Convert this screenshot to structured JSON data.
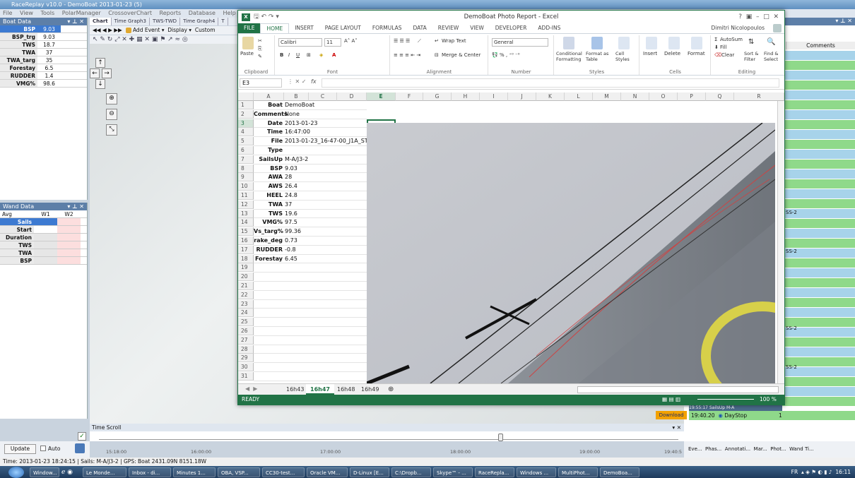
{
  "rr": {
    "title": "RaceReplay v10.0 - DemoBoat 2013-01-23 (5)",
    "menu": [
      "File",
      "View",
      "Tools",
      "PolarManager",
      "CrossoverChart",
      "Reports",
      "Database",
      "Help"
    ],
    "boat_panel": {
      "title": "Boat Data",
      "rows": [
        {
          "label": "BSP",
          "value": "9.03"
        },
        {
          "label": "BSP_trg",
          "value": "9.03"
        },
        {
          "label": "TWS",
          "value": "18.7"
        },
        {
          "label": "TWA",
          "value": "37"
        },
        {
          "label": "TWA_targ",
          "value": "35"
        },
        {
          "label": "Forestay",
          "value": "6.5"
        },
        {
          "label": "RUDDER",
          "value": "1.4"
        },
        {
          "label": "VMG%",
          "value": "98.6"
        }
      ]
    },
    "wand_panel": {
      "title": "Wand Data",
      "headers": [
        "Avg",
        "W1",
        "W2"
      ],
      "rows": [
        "Sails",
        "Start",
        "Duration",
        "TWS",
        "TWA",
        "BSP"
      ]
    },
    "tabs": [
      "Chart",
      "Time Graph3",
      "TWS-TWD",
      "Time Graph4",
      "T"
    ],
    "toolbar": {
      "add_event": "Add Event",
      "display": "Display",
      "custom": "Custom"
    },
    "right_panel": {
      "header": "Comments",
      "labels": [
        "SS-2",
        "SS-2",
        "SS-2",
        "SS-2"
      ],
      "events": [
        {
          "time": "19:40.20",
          "name": "DayStop",
          "value": "1"
        }
      ],
      "partial_row": {
        "time": "19:55:17",
        "name": "SailsUp",
        "value": "M-A"
      },
      "download": "Download"
    },
    "timescroll": {
      "title": "Time Scroll",
      "ticks": [
        "15:18:00",
        "16:00:00",
        "17:00:00",
        "18:00:00",
        "19:00:00",
        "19:40:5"
      ]
    },
    "bottom": {
      "update": "Update",
      "auto": "Auto"
    },
    "statusline": {
      "time": "Time: 2013-01-23 18:24:15",
      "sails": "Sails: M-A/J3-2",
      "gps": "GPS: Boat 2431.09N 8151.18W"
    },
    "bottom_tabs": [
      "Eve...",
      "Phas...",
      "Annotati...",
      "Mar...",
      "Phot...",
      "Wand Ti..."
    ]
  },
  "excel": {
    "title": "DemoBoat Photo Report - Excel",
    "user": "Dimitri Nicolopoulos",
    "tabs": [
      "FILE",
      "HOME",
      "INSERT",
      "PAGE LAYOUT",
      "FORMULAS",
      "DATA",
      "REVIEW",
      "VIEW",
      "DEVELOPER",
      "ADD-INS"
    ],
    "ribbon": {
      "paste": "Paste",
      "font_name": "Calibri",
      "font_size": "11",
      "wrap_text": "Wrap Text",
      "merge": "Merge & Center",
      "number_format": "General",
      "cond_format": "Conditional Formatting",
      "format_table": "Format as Table",
      "cell_styles": "Cell Styles",
      "insert": "Insert",
      "delete": "Delete",
      "format": "Format",
      "autosum": "AutoSum",
      "fill": "Fill",
      "clear": "Clear",
      "sort": "Sort & Filter",
      "find": "Find & Select",
      "groups": [
        "Clipboard",
        "Font",
        "Alignment",
        "Number",
        "Styles",
        "Cells",
        "Editing"
      ]
    },
    "name_box": "E3",
    "fx": "fx",
    "columns": [
      "A",
      "B",
      "C",
      "D",
      "E",
      "F",
      "G",
      "H",
      "I",
      "J",
      "K",
      "L",
      "M",
      "N",
      "O",
      "P",
      "Q",
      "R"
    ],
    "rows": [
      {
        "label": "Boat",
        "value": "DemoBoat"
      },
      {
        "label": "Comments",
        "value": "None"
      },
      {
        "label": "Date",
        "value": "2013-01-23"
      },
      {
        "label": "Time",
        "value": "16:47:00"
      },
      {
        "label": "File",
        "value": "2013-01-23_16-47-00_J1A_STBD"
      },
      {
        "label": "Type",
        "value": ""
      },
      {
        "label": "SailsUp",
        "value": "M-A/J3-2"
      },
      {
        "label": "BSP",
        "value": "9.03"
      },
      {
        "label": "AWA",
        "value": "28"
      },
      {
        "label": "AWS",
        "value": "26.4"
      },
      {
        "label": "HEEL",
        "value": "24.8"
      },
      {
        "label": "TWA",
        "value": "37"
      },
      {
        "label": "TWS",
        "value": "19.6"
      },
      {
        "label": "VMG%",
        "value": "97.5"
      },
      {
        "label": "Vs_targ%",
        "value": "99.36"
      },
      {
        "label": "rake_deg",
        "value": "0.73"
      },
      {
        "label": "RUDDER",
        "value": "-0.8"
      },
      {
        "label": "Forestay",
        "value": "6.45"
      }
    ],
    "row_count": 31,
    "sheets": [
      "16h43",
      "16h47",
      "16h48",
      "16h49"
    ],
    "active_sheet": "16h47",
    "status": "READY",
    "zoom": "100 %",
    "accent": "#217346"
  },
  "taskbar": {
    "items": [
      "Window...",
      "Le Monde...",
      "Inbox - di...",
      "Minutes 1...",
      "OBA, VSP...",
      "CC30-test...",
      "Oracle VM...",
      "D-Linux [E...",
      "C:\\Dropb...",
      "Skype™ - ...",
      "RaceRepla...",
      "Windows ...",
      "MultiPhot...",
      "DemoBoa..."
    ],
    "lang": "FR",
    "clock": "16:11"
  }
}
